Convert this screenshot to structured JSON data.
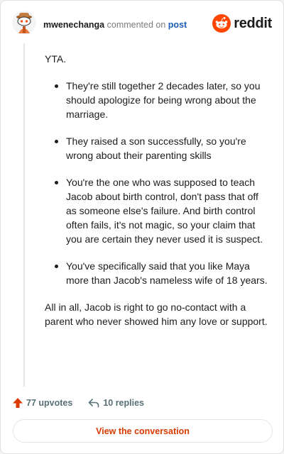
{
  "header": {
    "username": "mwenechanga",
    "action_text": "commented on",
    "post_link": "post",
    "logo_text": "reddit"
  },
  "comment": {
    "intro": "YTA.",
    "bullets": [
      "They're still together 2 decades later, so you should apologize for being wrong about the marriage.",
      "They raised a son successfully, so you're wrong about their parenting skills",
      "You're the one who was supposed to teach Jacob about birth control, don't pass that off as someone else's failure. And birth control often fails, it's not magic, so your claim that you are certain they never used it is suspect.",
      "You've specifically said that you like Maya more than Jacob's nameless wife of 18 years."
    ],
    "outro": "All in all, Jacob is right to go no-contact with a parent who never showed him any love or support."
  },
  "footer": {
    "upvotes": "77 upvotes",
    "replies": "10 replies"
  },
  "cta": {
    "label": "View the conversation"
  },
  "colors": {
    "reddit_orange": "#ff4500",
    "upvote_red": "#d93a00",
    "link_blue": "#1a5fb4"
  },
  "icons": {
    "avatar": "snoo-avatar-icon",
    "logo": "reddit-logo-icon",
    "upvote": "upvote-arrow-icon",
    "reply": "reply-arrow-icon"
  }
}
